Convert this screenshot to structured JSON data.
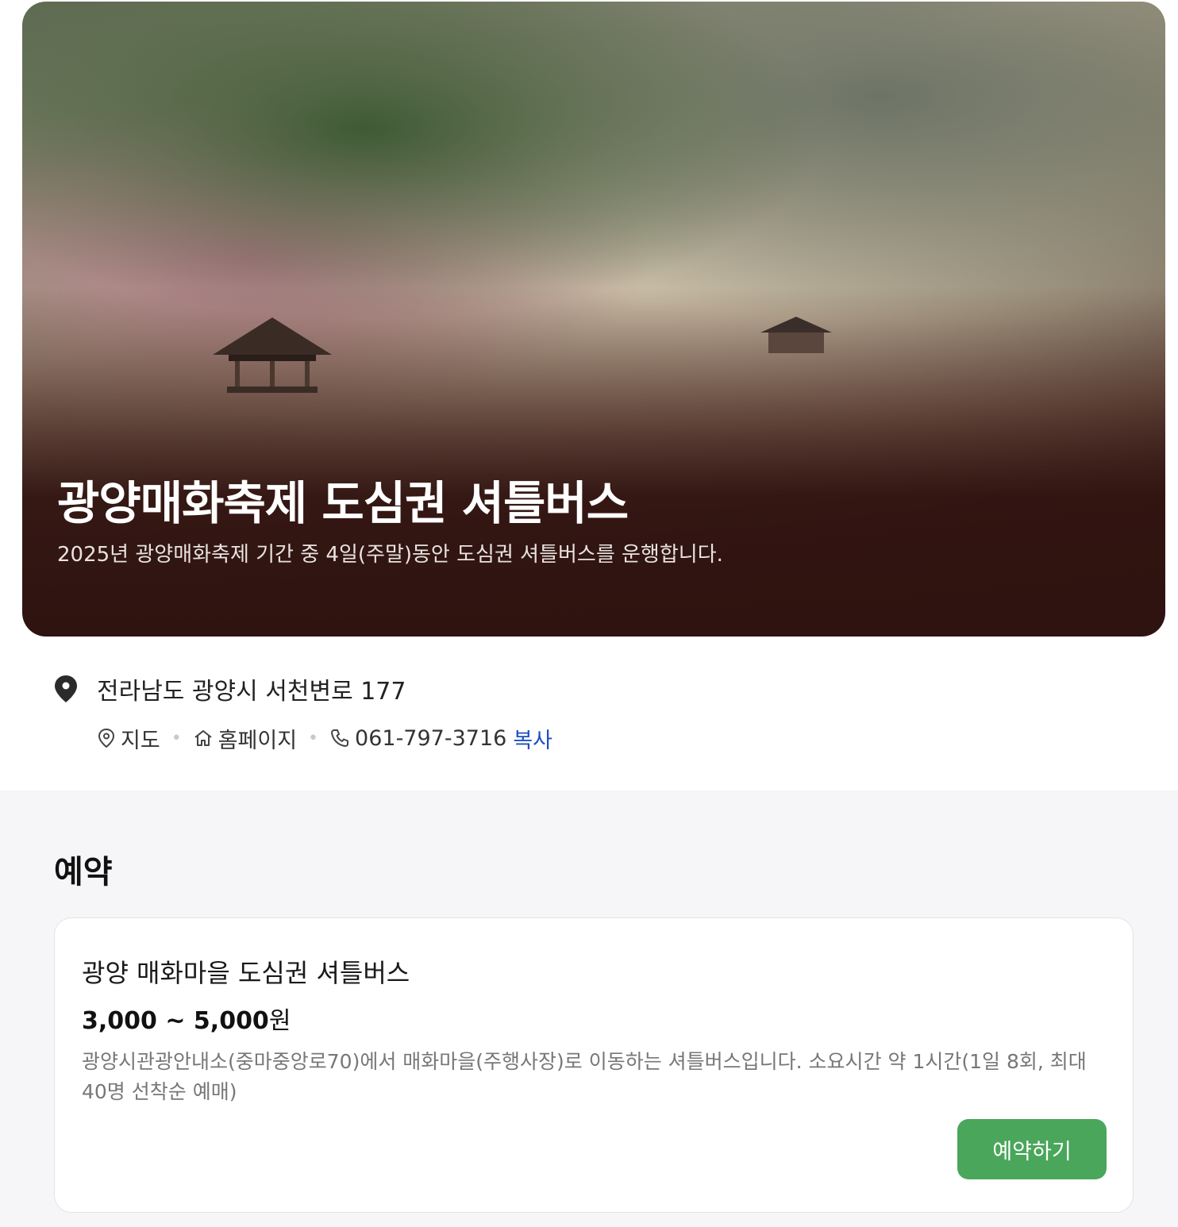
{
  "hero": {
    "title": "광양매화축제 도심권 셔틀버스",
    "subtitle": "2025년 광양매화축제 기간 중 4일(주말)동안 도심권 셔틀버스를 운행합니다."
  },
  "info": {
    "address": "전라남도 광양시 서천변로 177",
    "address_icon": "location-pin-icon",
    "links": {
      "map_label": "지도",
      "homepage_label": "홈페이지",
      "phone": "061-797-3716",
      "copy_label": "복사"
    },
    "separator": "•"
  },
  "booking": {
    "section_title": "예약",
    "card": {
      "title": "광양 매화마을 도심권 셔틀버스",
      "price_range": "3,000 ~ 5,000",
      "price_unit": "원",
      "description": "광양시관광안내소(중마중앙로70)에서 매화마을(주행사장)로 이동하는 셔틀버스입니다. 소요시간 약 1시간(1일 8회, 최대 40명 선착순 예매)",
      "reserve_label": "예약하기"
    }
  },
  "colors": {
    "accent_green": "#4aa65a",
    "link_blue": "#1f4fbf",
    "hero_overlay": "#2e1310",
    "section_bg": "#f6f6f8"
  }
}
